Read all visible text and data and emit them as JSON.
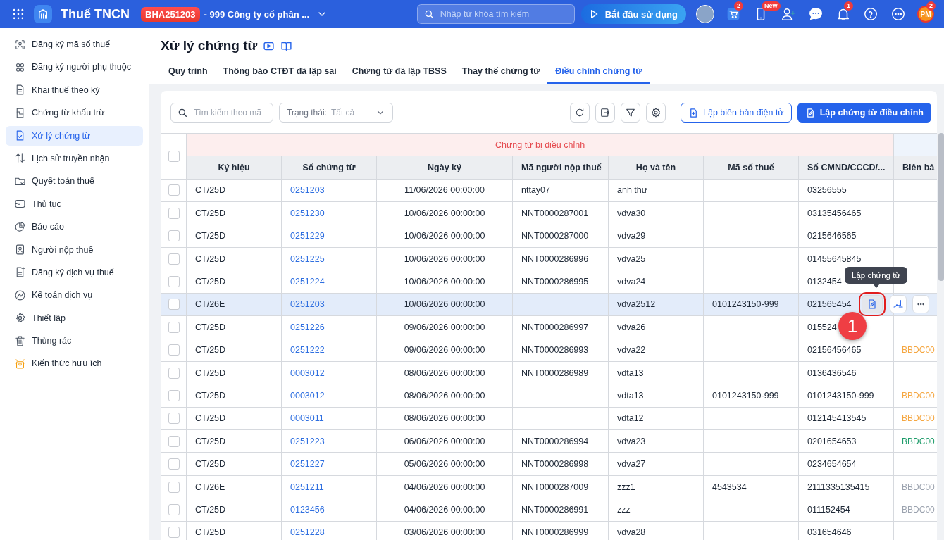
{
  "topbar": {
    "app_name": "Thuế TNCN",
    "tenant_code": "BHA251203",
    "company": "- 999 Công ty cổ phần ...",
    "search": {
      "placeholder": "Nhập từ khóa tìm kiếm"
    },
    "start_button": "Bắt đầu sử dụng",
    "cart_badge": "2",
    "phone_badge": "New",
    "bell_badge": "1",
    "user_initials": "PM",
    "user_badge": "2"
  },
  "sidebar": {
    "items": [
      {
        "label": "Đăng ký mã số thuế",
        "selected": false
      },
      {
        "label": "Đăng ký người phụ thuộc",
        "selected": false
      },
      {
        "label": "Khai thuế theo kỳ",
        "selected": false
      },
      {
        "label": "Chứng từ khấu trừ",
        "selected": false
      },
      {
        "label": "Xử lý chứng từ",
        "selected": true
      },
      {
        "label": "Lịch sử truyền nhận",
        "selected": false
      },
      {
        "label": "Quyết toán thuế",
        "selected": false
      },
      {
        "label": "Thủ tục",
        "selected": false
      },
      {
        "label": "Báo cáo",
        "selected": false
      },
      {
        "label": "Người nộp thuế",
        "selected": false
      },
      {
        "label": "Đăng ký dịch vụ thuế",
        "selected": false
      },
      {
        "label": "Kế toán dịch vụ",
        "selected": false
      },
      {
        "label": "Thiết lập",
        "selected": false
      },
      {
        "label": "Thùng rác",
        "selected": false
      },
      {
        "label": "Kiến thức hữu ích",
        "selected": false
      }
    ]
  },
  "page": {
    "title": "Xử lý chứng từ",
    "tabs": [
      {
        "label": "Quy trình",
        "selected": false
      },
      {
        "label": "Thông báo CTĐT đã lập sai",
        "selected": false
      },
      {
        "label": "Chứng từ đã lập TBSS",
        "selected": false
      },
      {
        "label": "Thay thế chứng từ",
        "selected": false
      },
      {
        "label": "Điều chỉnh chứng từ",
        "selected": true
      }
    ]
  },
  "toolbar": {
    "search": {
      "placeholder": "Tìm kiếm theo mã"
    },
    "status_filter": {
      "label": "Trạng thái:",
      "value": "Tất cả"
    },
    "create_report_button": "Lập biên bản điện tử",
    "create_adjust_button": "Lập chứng từ điều chỉnh"
  },
  "table": {
    "select_all_checked": false,
    "group_header": "Chứng từ bị điều chỉnh",
    "columns": [
      "Ký hiệu",
      "Số chứng từ",
      "Ngày ký",
      "Mã người nộp thuế",
      "Họ và tên",
      "Mã số thuế",
      "Số CMND/CCCD/...",
      "Biên bả"
    ],
    "rows": [
      {
        "checked": false,
        "highlighted": false,
        "cells": [
          "CT/25D",
          "0251203",
          "11/06/2026 00:00:00",
          "nttay07",
          "anh thư",
          "",
          "03256555"
        ]
      },
      {
        "checked": false,
        "highlighted": false,
        "cells": [
          "CT/25D",
          "0251230",
          "10/06/2026 00:00:00",
          "NNT0000287001",
          "vdva30",
          "",
          "03135456465"
        ]
      },
      {
        "checked": false,
        "highlighted": false,
        "cells": [
          "CT/25D",
          "0251229",
          "10/06/2026 00:00:00",
          "NNT0000287000",
          "vdva29",
          "",
          "0215646565"
        ]
      },
      {
        "checked": false,
        "highlighted": false,
        "cells": [
          "CT/25D",
          "0251225",
          "10/06/2026 00:00:00",
          "NNT0000286996",
          "vdva25",
          "",
          "01455645845"
        ]
      },
      {
        "checked": false,
        "highlighted": false,
        "cells": [
          "CT/25D",
          "0251224",
          "10/06/2026 00:00:00",
          "NNT0000286995",
          "vdva24",
          "",
          "0132454"
        ]
      },
      {
        "checked": false,
        "highlighted": true,
        "cells": [
          "CT/26E",
          "0251203",
          "10/06/2026 00:00:00",
          "",
          "vdva2512",
          "0101243150-999",
          "021565454"
        ]
      },
      {
        "checked": false,
        "highlighted": false,
        "cells": [
          "CT/25D",
          "0251226",
          "09/06/2026 00:00:00",
          "NNT0000286997",
          "vdva26",
          "",
          "015524"
        ]
      },
      {
        "checked": false,
        "highlighted": false,
        "cells": [
          "CT/25D",
          "0251222",
          "09/06/2026 00:00:00",
          "NNT0000286993",
          "vdva22",
          "",
          "02156456465"
        ],
        "report": {
          "text": "BBDC00",
          "color": "#f5a742"
        }
      },
      {
        "checked": false,
        "highlighted": false,
        "cells": [
          "CT/25D",
          "0003012",
          "08/06/2026 00:00:00",
          "NNT0000286989",
          "vdta13",
          "",
          "0136436546"
        ]
      },
      {
        "checked": false,
        "highlighted": false,
        "cells": [
          "CT/25D",
          "0003012",
          "08/06/2026 00:00:00",
          "",
          "vdta13",
          "0101243150-999",
          "0101243150-999"
        ],
        "report": {
          "text": "BBDC00",
          "color": "#f5a742"
        }
      },
      {
        "checked": false,
        "highlighted": false,
        "cells": [
          "CT/25D",
          "0003011",
          "08/06/2026 00:00:00",
          "",
          "vdta12",
          "",
          "012145413545"
        ],
        "report": {
          "text": "BBDC00",
          "color": "#f5a742"
        }
      },
      {
        "checked": false,
        "highlighted": false,
        "cells": [
          "CT/25D",
          "0251223",
          "06/06/2026 00:00:00",
          "NNT0000286994",
          "vdva23",
          "",
          "0201654653"
        ],
        "report": {
          "text": "BBDC00",
          "color": "#1f9d6b"
        }
      },
      {
        "checked": false,
        "highlighted": false,
        "cells": [
          "CT/25D",
          "0251227",
          "05/06/2026 00:00:00",
          "NNT0000286998",
          "vdva27",
          "",
          "0234654654"
        ]
      },
      {
        "checked": false,
        "highlighted": false,
        "cells": [
          "CT/26E",
          "0251211",
          "04/06/2026 00:00:00",
          "NNT0000287009",
          "zzz1",
          "4543534",
          "2111335135415"
        ],
        "report": {
          "text": "BBDC00",
          "color": "#9ca3af"
        }
      },
      {
        "checked": false,
        "highlighted": false,
        "cells": [
          "CT/25D",
          "0123456",
          "04/06/2026 00:00:00",
          "NNT0000286991",
          "zzz",
          "",
          "011152454"
        ],
        "report": {
          "text": "BBDC00",
          "color": "#9ca3af"
        }
      },
      {
        "checked": false,
        "highlighted": false,
        "cells": [
          "CT/25D",
          "0251228",
          "03/06/2026 00:00:00",
          "NNT0000286999",
          "vdva28",
          "",
          "031654646"
        ]
      }
    ]
  },
  "hover_actions": {
    "tooltip": "Lập chứng từ",
    "step": "1"
  }
}
